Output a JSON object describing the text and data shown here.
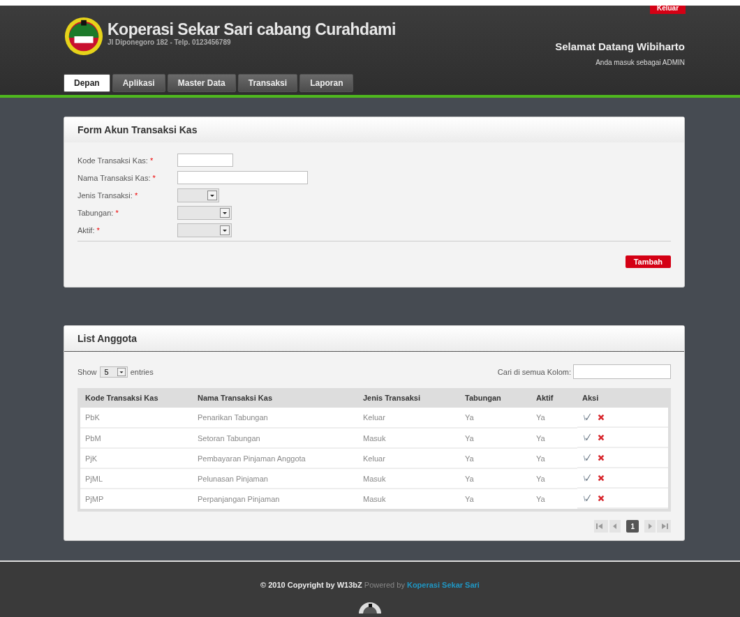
{
  "header": {
    "logout": "Keluar",
    "title": "Koperasi Sekar Sari cabang Curahdami",
    "address": "Jl Diponegoro 182 - Telp. 0123456789",
    "welcome": "Selamat Datang Wibiharto",
    "role": "Anda masuk sebagai ADMIN"
  },
  "tabs": [
    {
      "label": "Depan",
      "selected": true
    },
    {
      "label": "Aplikasi",
      "selected": false
    },
    {
      "label": "Master Data",
      "selected": false
    },
    {
      "label": "Transaksi",
      "selected": false
    },
    {
      "label": "Laporan",
      "selected": false
    }
  ],
  "form": {
    "title": "Form Akun Transaksi Kas",
    "required_mark": "*",
    "fields": [
      {
        "label": "Kode Transaksi Kas:",
        "kind": "text"
      },
      {
        "label": "Nama Transaksi Kas:",
        "kind": "text"
      },
      {
        "label": "Jenis Transaksi:",
        "kind": "select"
      },
      {
        "label": "Tabungan:",
        "kind": "select"
      },
      {
        "label": "Aktif:",
        "kind": "select"
      }
    ],
    "submit": "Tambah"
  },
  "list": {
    "title": "List Anggota",
    "show": "Show",
    "page_size": "5",
    "entries": "entries",
    "search_label": "Cari di semua Kolom:",
    "columns": [
      "Kode Transaksi Kas",
      "Nama Transaksi Kas",
      "Jenis Transaksi",
      "Tabungan",
      "Aktif",
      "Aksi"
    ],
    "rows": [
      [
        "PbK",
        "Penarikan Tabungan",
        "Keluar",
        "Ya",
        "Ya"
      ],
      [
        "PbM",
        "Setoran Tabungan",
        "Masuk",
        "Ya",
        "Ya"
      ],
      [
        "PjK",
        "Pembayaran Pinjaman Anggota",
        "Keluar",
        "Ya",
        "Ya"
      ],
      [
        "PjML",
        "Pelunasan Pinjaman",
        "Masuk",
        "Ya",
        "Ya"
      ],
      [
        "PjMP",
        "Perpanjangan Pinjaman",
        "Masuk",
        "Ya",
        "Ya"
      ]
    ],
    "pages": [
      {
        "label": "1",
        "selected": true
      }
    ]
  },
  "footer": {
    "text": "**© 2010 Copyright by W13bZ** Powered by",
    "link": "Koperasi Sekar Sari"
  }
}
